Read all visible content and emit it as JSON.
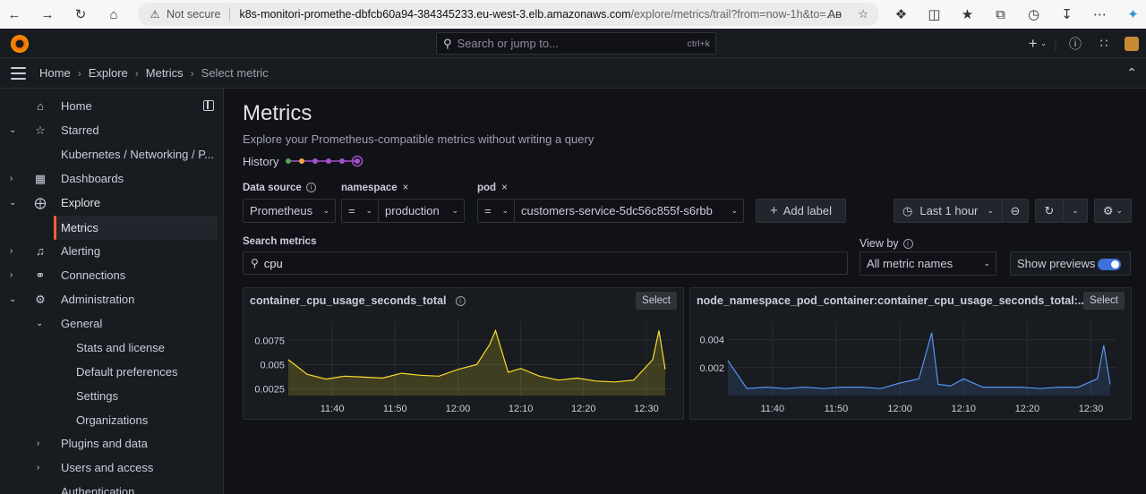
{
  "browser": {
    "not_secure": "Not secure",
    "url_host": "k8s-monitori-promethe-dbfcb60a94-384345233.eu-west-3.elb.amazonaws.com",
    "url_path": "/explore/metrics/trail?from=now-1h&to=..."
  },
  "topnav": {
    "search_placeholder": "Search or jump to...",
    "search_shortcut": "ctrl+k",
    "plus_label": "+"
  },
  "breadcrumb": [
    "Home",
    "Explore",
    "Metrics",
    "Select metric"
  ],
  "sidebar": {
    "items": [
      {
        "label": "Home",
        "icon": "home-icon"
      },
      {
        "label": "Starred",
        "icon": "star-icon",
        "expanded": true
      },
      {
        "label": "Kubernetes / Networking / P..."
      },
      {
        "label": "Dashboards",
        "icon": "dashboards-grid-icon"
      },
      {
        "label": "Explore",
        "icon": "compass-icon",
        "expanded": true
      },
      {
        "label": "Metrics",
        "active": true
      },
      {
        "label": "Alerting",
        "icon": "bell-icon"
      },
      {
        "label": "Connections",
        "icon": "plug-icon"
      },
      {
        "label": "Administration",
        "icon": "cog-icon",
        "expanded": true
      },
      {
        "label": "General",
        "expanded": true
      },
      {
        "label": "Stats and license"
      },
      {
        "label": "Default preferences"
      },
      {
        "label": "Settings"
      },
      {
        "label": "Organizations"
      },
      {
        "label": "Plugins and data"
      },
      {
        "label": "Users and access"
      },
      {
        "label": "Authentication"
      }
    ]
  },
  "page": {
    "title": "Metrics",
    "subtitle": "Explore your Prometheus-compatible metrics without writing a query",
    "history_label": "History",
    "history_colors": [
      "#56a64b",
      "#f2a445",
      "#a352cc",
      "#a352cc",
      "#a352cc",
      "#a352cc"
    ]
  },
  "filters": {
    "datasource_label": "Data source",
    "datasource_value": "Prometheus",
    "namespace_label": "namespace",
    "namespace_op": "=",
    "namespace_value": "production",
    "pod_label": "pod",
    "pod_op": "=",
    "pod_value": "customers-service-5dc56c855f-s6rbb",
    "add_label": "Add label",
    "time_range": "Last 1 hour",
    "remove_glyph": "×"
  },
  "search": {
    "label": "Search metrics",
    "value": "cpu",
    "view_by_label": "View by",
    "view_by_value": "All metric names",
    "show_previews_label": "Show previews",
    "show_previews_on": true
  },
  "panels": [
    {
      "title": "container_cpu_usage_seconds_total",
      "select_label": "Select",
      "color": "#fade2a",
      "fill": "rgba(250,222,42,0.18)",
      "yticks": [
        "0.0075",
        "0.005",
        "0.0025"
      ],
      "xticks": [
        "11:40",
        "11:50",
        "12:00",
        "12:10",
        "12:20",
        "12:30"
      ]
    },
    {
      "title": "node_namespace_pod_container:container_cpu_usage_seconds_total:...",
      "select_label": "Select",
      "color": "#5794f2",
      "fill": "rgba(87,148,242,0.15)",
      "yticks": [
        "0.004",
        "0.002"
      ],
      "xticks": [
        "11:40",
        "11:50",
        "12:00",
        "12:10",
        "12:20",
        "12:30"
      ]
    }
  ],
  "chart_data": [
    {
      "type": "area",
      "title": "container_cpu_usage_seconds_total",
      "x": [
        "11:33",
        "11:36",
        "11:39",
        "11:42",
        "11:45",
        "11:48",
        "11:51",
        "11:54",
        "11:57",
        "12:00",
        "12:03",
        "12:05",
        "12:06",
        "12:08",
        "12:10",
        "12:13",
        "12:16",
        "12:19",
        "12:22",
        "12:25",
        "12:28",
        "12:31",
        "12:32",
        "12:33"
      ],
      "values": [
        0.0055,
        0.004,
        0.0035,
        0.0038,
        0.0037,
        0.0036,
        0.0041,
        0.0039,
        0.0038,
        0.0045,
        0.005,
        0.007,
        0.0085,
        0.0042,
        0.0046,
        0.0038,
        0.0034,
        0.0036,
        0.0033,
        0.0032,
        0.0034,
        0.0055,
        0.0085,
        0.0045
      ],
      "ylim": [
        0.0018,
        0.009
      ]
    },
    {
      "type": "area",
      "title": "node_namespace_pod_container:container_cpu_usage_seconds_total:...",
      "x": [
        "11:33",
        "11:36",
        "11:39",
        "11:42",
        "11:45",
        "11:48",
        "11:51",
        "11:54",
        "11:57",
        "12:00",
        "12:03",
        "12:05",
        "12:06",
        "12:08",
        "12:10",
        "12:13",
        "12:16",
        "12:19",
        "12:22",
        "12:25",
        "12:28",
        "12:31",
        "12:32",
        "12:33"
      ],
      "values": [
        0.0025,
        0.0005,
        0.0006,
        0.0005,
        0.0006,
        0.0005,
        0.0006,
        0.0006,
        0.0005,
        0.0009,
        0.0012,
        0.0045,
        0.0008,
        0.0007,
        0.0012,
        0.0006,
        0.0006,
        0.0006,
        0.0005,
        0.0006,
        0.0006,
        0.0012,
        0.0036,
        0.0008
      ],
      "ylim": [
        0,
        0.005
      ]
    }
  ]
}
